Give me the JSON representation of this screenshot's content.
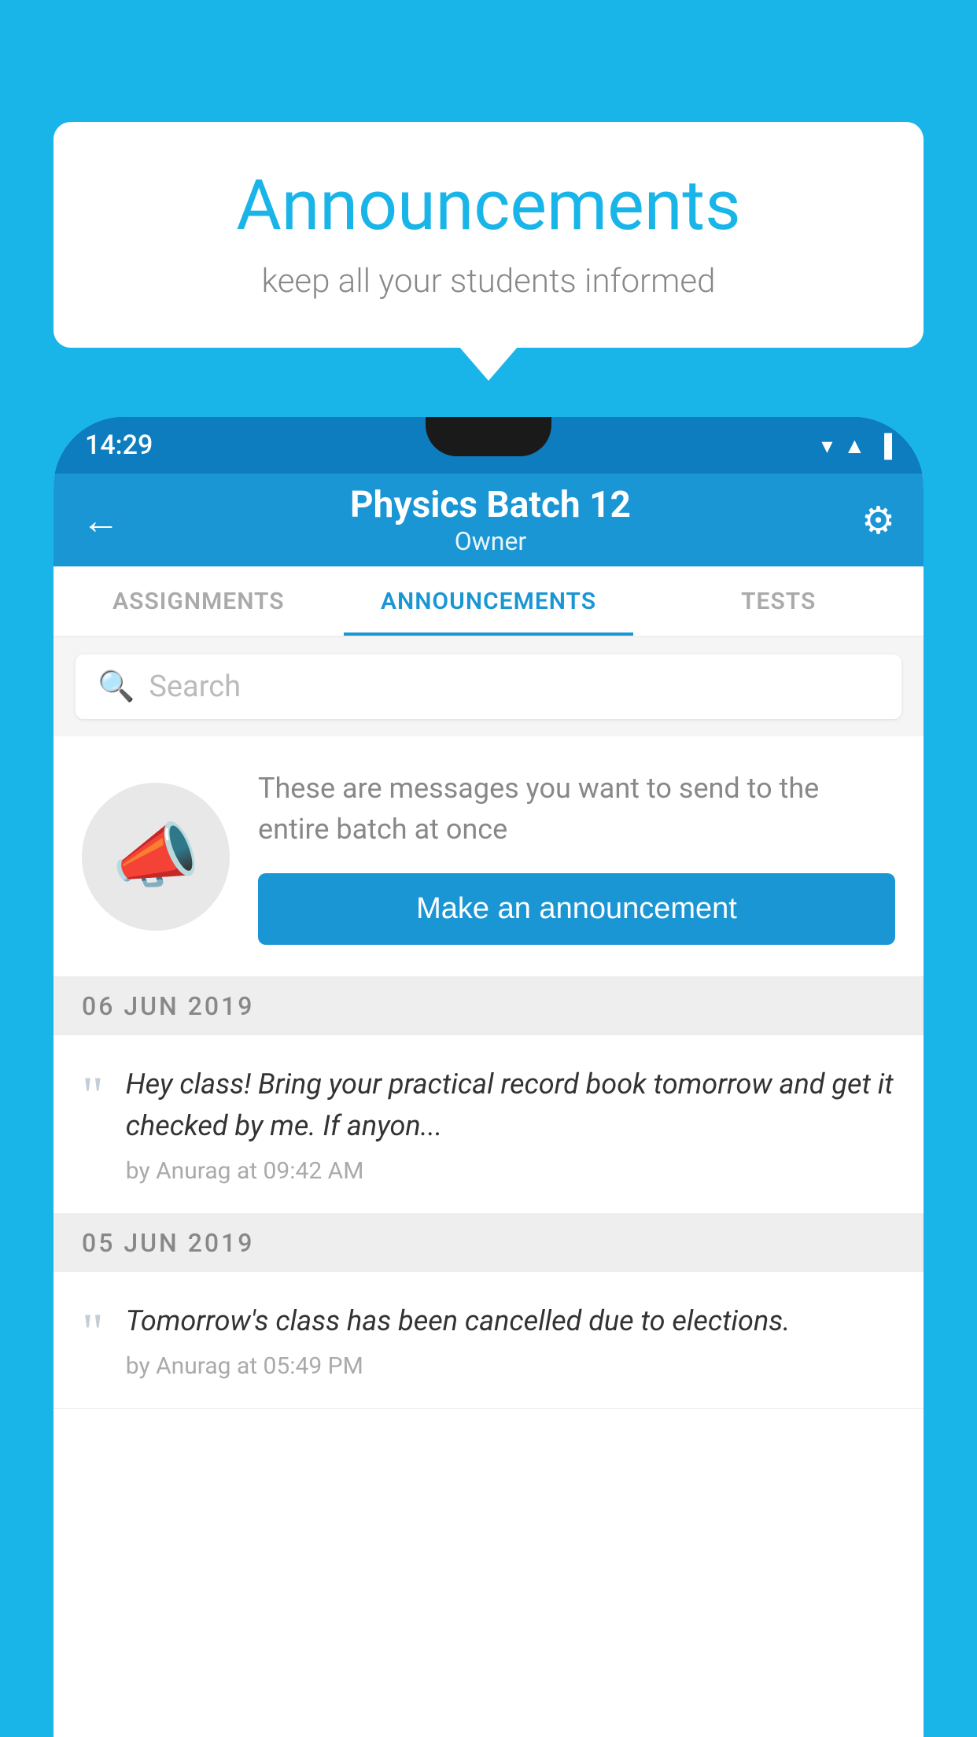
{
  "background_color": "#1ab5e8",
  "speech_bubble": {
    "title": "Announcements",
    "subtitle": "keep all your students informed"
  },
  "status_bar": {
    "time": "14:29",
    "icons": [
      "wifi",
      "signal",
      "battery"
    ]
  },
  "top_bar": {
    "title": "Physics Batch 12",
    "subtitle": "Owner",
    "back_label": "←",
    "gear_label": "⚙"
  },
  "tabs": [
    {
      "label": "ASSIGNMENTS",
      "active": false
    },
    {
      "label": "ANNOUNCEMENTS",
      "active": true
    },
    {
      "label": "TESTS",
      "active": false
    }
  ],
  "search": {
    "placeholder": "Search"
  },
  "promo": {
    "description": "These are messages you want to send to the entire batch at once",
    "button_label": "Make an announcement"
  },
  "announcements": [
    {
      "date": "06  JUN  2019",
      "text": "Hey class! Bring your practical record book tomorrow and get it checked by me. If anyon...",
      "meta": "by Anurag at 09:42 AM"
    },
    {
      "date": "05  JUN  2019",
      "text": "Tomorrow's class has been cancelled due to elections.",
      "meta": "by Anurag at 05:49 PM"
    }
  ]
}
